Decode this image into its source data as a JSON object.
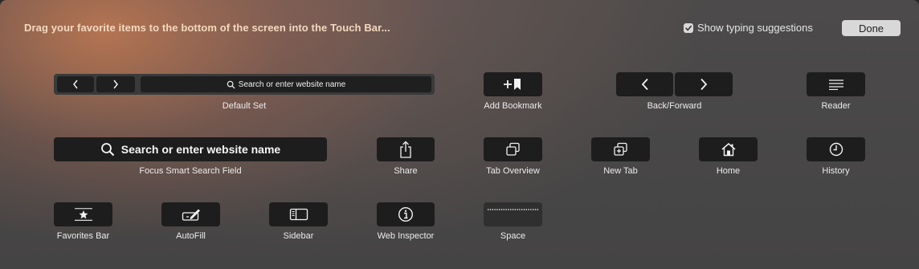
{
  "header": {
    "instruction": "Drag your favorite items to the bottom of the screen into the Touch Bar...",
    "show_suggestions_label": "Show typing suggestions",
    "show_suggestions_checked": true,
    "done_label": "Done"
  },
  "items": {
    "default_set": {
      "label": "Default Set",
      "search_text": "Search or enter website name"
    },
    "add_bookmark": {
      "label": "Add Bookmark"
    },
    "back_forward": {
      "label": "Back/Forward"
    },
    "reader": {
      "label": "Reader"
    },
    "focus_search": {
      "label": "Focus Smart Search Field",
      "search_text": "Search or enter website name"
    },
    "share": {
      "label": "Share"
    },
    "tab_overview": {
      "label": "Tab Overview"
    },
    "new_tab": {
      "label": "New Tab"
    },
    "home": {
      "label": "Home"
    },
    "history": {
      "label": "History"
    },
    "favorites_bar": {
      "label": "Favorites Bar"
    },
    "autofill": {
      "label": "AutoFill"
    },
    "sidebar": {
      "label": "Sidebar"
    },
    "web_inspector": {
      "label": "Web Inspector"
    },
    "space": {
      "label": "Space"
    }
  },
  "icons": {
    "back": "chevron-left-icon",
    "forward": "chevron-right-icon",
    "search": "magnifier-icon",
    "add_bookmark": "plus-bookmark-icon",
    "reader": "lines-icon",
    "share": "share-icon",
    "tab_overview": "tabs-icon",
    "new_tab": "new-tab-icon",
    "home": "house-icon",
    "history": "clock-icon",
    "favorites_bar": "star-icon",
    "autofill": "pen-field-icon",
    "sidebar": "sidebar-icon",
    "web_inspector": "info-icon",
    "space": "dotted-line-icon"
  },
  "colors": {
    "instruction_text": "#f3d9bf",
    "key_background": "#1d1d1d",
    "done_button": "#d8d8d8"
  }
}
